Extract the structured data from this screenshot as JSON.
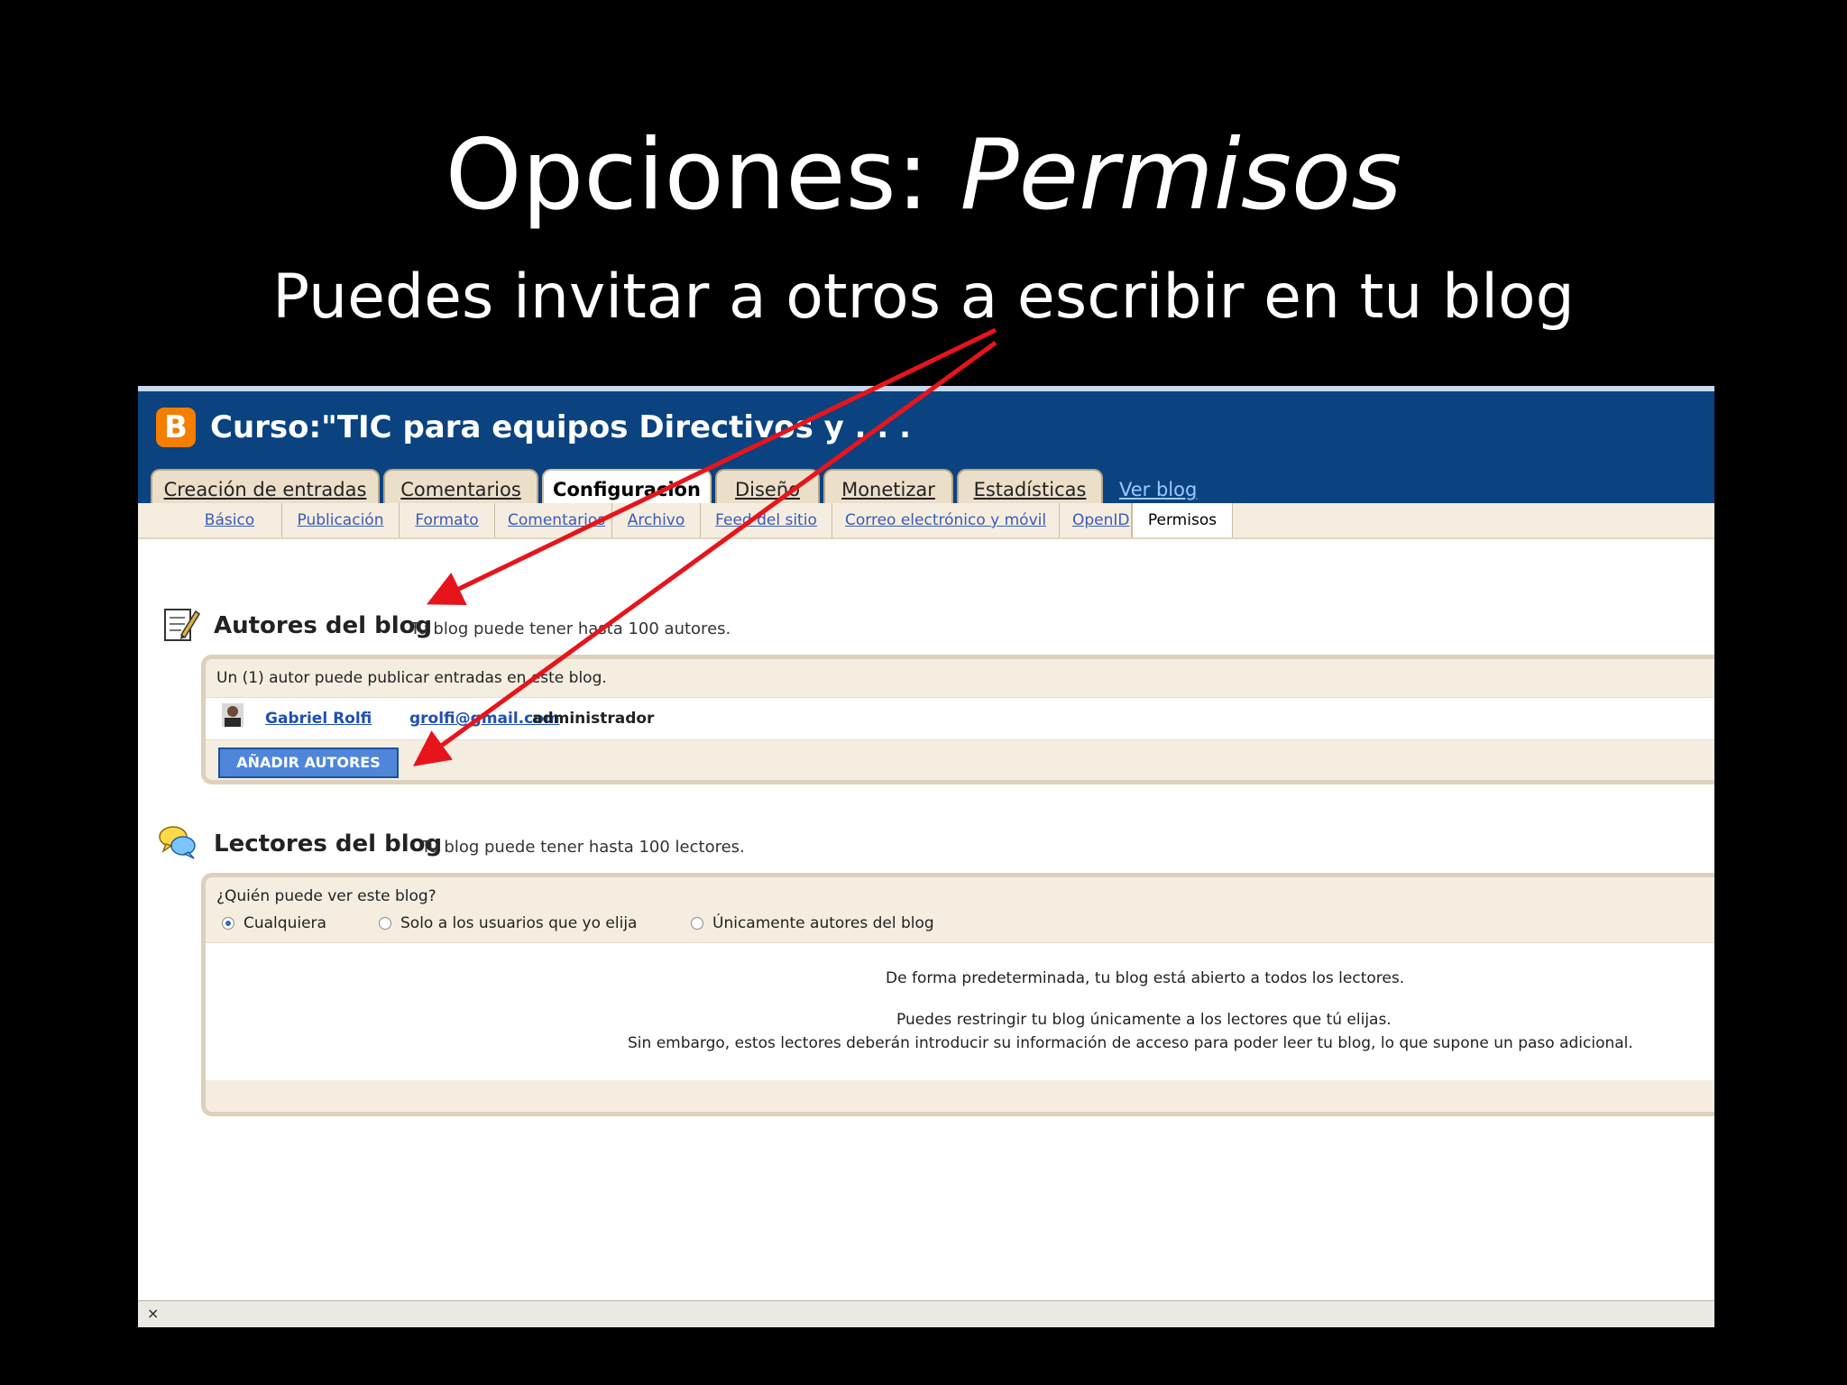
{
  "slide": {
    "title_plain": "Opciones: ",
    "title_italic": "Permisos",
    "subtitle": "Puedes invitar a otros a escribir en tu blog"
  },
  "header": {
    "logo_letter": "B",
    "blog_title": "Curso:\"TIC para equipos Directivos y . . .",
    "tabs": [
      {
        "label": "Creación de entradas"
      },
      {
        "label": "Comentarios"
      },
      {
        "label": "Configuración"
      },
      {
        "label": "Diseño"
      },
      {
        "label": "Monetizar"
      },
      {
        "label": "Estadísticas"
      }
    ],
    "active_tab": "Configuración",
    "view_blog": "Ver blog"
  },
  "subnav": {
    "items": [
      {
        "label": "Básico"
      },
      {
        "label": "Publicación"
      },
      {
        "label": "Formato"
      },
      {
        "label": "Comentarios"
      },
      {
        "label": "Archivo"
      },
      {
        "label": "Feed del sitio"
      },
      {
        "label": "Correo electrónico y móvil"
      },
      {
        "label": "OpenID"
      },
      {
        "label": "Permisos"
      }
    ],
    "active": "Permisos"
  },
  "authors": {
    "title": "Autores del blog",
    "note": "Tu blog puede tener hasta 100 autores.",
    "count_text": "Un (1) autor puede publicar entradas en este blog.",
    "rows": [
      {
        "name": "Gabriel Rolfi",
        "email": "grolfi@gmail.com",
        "role": "administrador"
      }
    ],
    "add_button": "AÑADIR AUTORES"
  },
  "readers": {
    "title": "Lectores del blog",
    "note": "Tu blog puede tener hasta 100 lectores.",
    "question": "¿Quién puede ver este blog?",
    "options": [
      {
        "label": "Cualquiera",
        "checked": true
      },
      {
        "label": "Solo a los usuarios que yo elija",
        "checked": false
      },
      {
        "label": "Únicamente autores del blog",
        "checked": false
      }
    ],
    "info_1": "De forma predeterminada, tu blog está abierto a todos los lectores.",
    "info_2": "Puedes restringir tu blog únicamente a los lectores que tú elijas.",
    "info_3": "Sin embargo, estos lectores deberán introducir su información de acceso para poder leer tu blog, lo que supone un paso adicional."
  },
  "statusbar": {
    "close_glyph": "×"
  },
  "colors": {
    "header_blue": "#0a4380",
    "logo_orange": "#f57d00",
    "arrow_red": "#e8141b",
    "button_blue": "#4f86d9"
  },
  "icons": [
    "blogger-logo-icon",
    "edit-notepad-icon",
    "avatar-photo-icon",
    "chat-bubbles-icon"
  ]
}
